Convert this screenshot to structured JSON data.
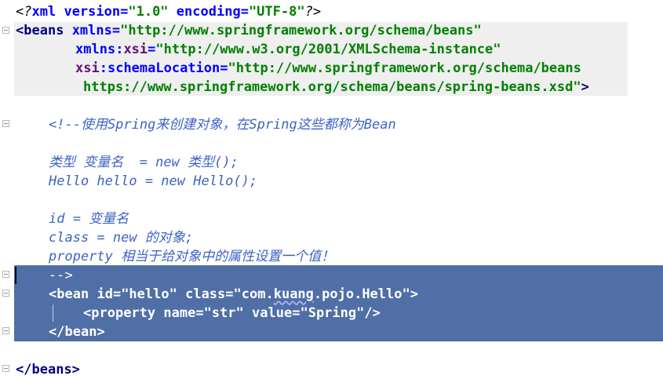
{
  "editor": {
    "language": "XML",
    "colors": {
      "tag": "#000080",
      "attribute": "#0000ff",
      "namespace_prefix": "#660e7a",
      "string_value": "#008000",
      "comment": "#3d63c4",
      "selection": "#4f6fa6",
      "current_block": "#efefef"
    },
    "lines": {
      "l1": {
        "open": "<?",
        "name": "xml",
        "a1": "version",
        "eq1": "=",
        "v1": "\"1.0\"",
        "a2": "encoding",
        "eq2": "=",
        "v2": "\"UTF-8\"",
        "close": "?>"
      },
      "l2": {
        "open": "<",
        "tag": "beans",
        "attr": "xmlns",
        "eq": "=",
        "val": "\"http://www.springframework.org/schema/beans\""
      },
      "l3": {
        "prefix": "xmlns",
        "colon": ":",
        "attr": "xsi",
        "eq": "=",
        "val": "\"http://www.w3.org/2001/XMLSchema-instance\""
      },
      "l4": {
        "prefix": "xsi",
        "colon": ":",
        "attr": "schemaLocation",
        "eq": "=",
        "val": "\"http://www.springframework.org/schema/beans"
      },
      "l5": {
        "val": "https://www.springframework.org/schema/beans/spring-beans.xsd\"",
        "close": ">"
      },
      "c1": "<!--使用Spring来创建对象，在Spring这些都称为Bean",
      "c2": "类型 变量名  = new 类型();",
      "c3": "Hello hello = new Hello();",
      "c4": "id = 变量名",
      "c5": "class = new 的对象;",
      "c6": "property 相当于给对象中的属性设置一个值！",
      "c7": "-->",
      "b1": {
        "open": "<",
        "tag": "bean",
        "a1": "id",
        "eq1": "=",
        "v1": "\"hello\"",
        "a2": "class",
        "eq2": "=",
        "v2a": "\"com.",
        "v2b": "kuang",
        "v2c": ".pojo.Hello\"",
        "close": ">"
      },
      "b2": {
        "open": "<",
        "tag": "property",
        "a1": "name",
        "eq1": "=",
        "v1": "\"str\"",
        "a2": "value",
        "eq2": "=",
        "v2": "\"Spring\"",
        "close": "/>"
      },
      "b3": {
        "open": "</",
        "tag": "bean",
        "close": ">"
      },
      "end": {
        "open": "</",
        "tag": "beans",
        "close": ">"
      }
    }
  }
}
